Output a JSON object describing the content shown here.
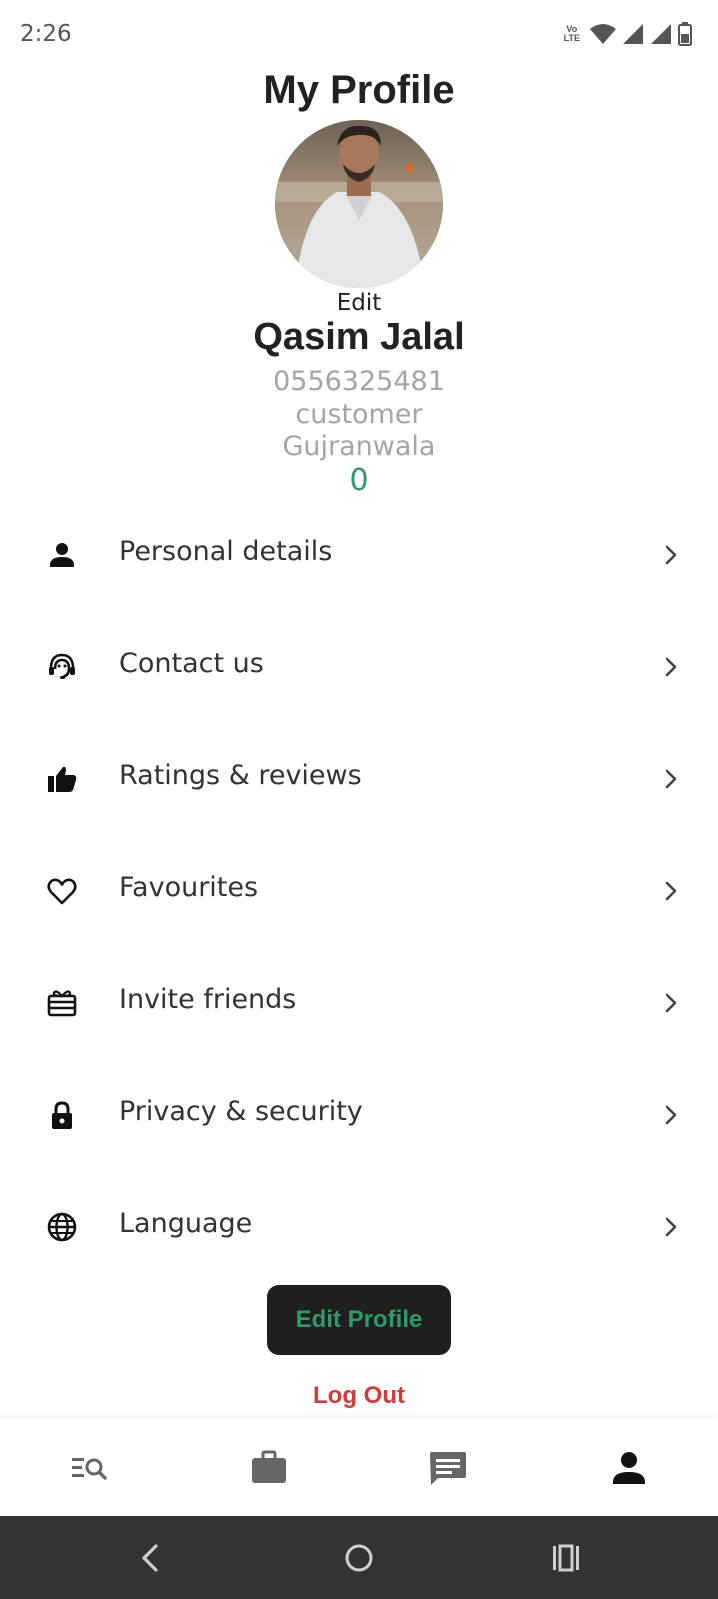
{
  "status_bar": {
    "time": "2:26",
    "volte_line1": "Vo",
    "volte_line2": "LTE",
    "icons": [
      "volte-icon",
      "wifi-icon",
      "signal-icon",
      "signal-icon",
      "battery-icon"
    ]
  },
  "header": {
    "title": "My Profile"
  },
  "profile": {
    "avatar_icon": "profile-photo",
    "edit_label": "Edit",
    "name": "Qasim Jalal",
    "phone": "0556325481",
    "role": "customer",
    "city": "Gujranwala",
    "count": "0"
  },
  "menu": {
    "items": [
      {
        "label": "Personal details",
        "icon": "person-icon"
      },
      {
        "label": "Contact us",
        "icon": "support-agent-icon"
      },
      {
        "label": "Ratings & reviews",
        "icon": "thumb-up-icon"
      },
      {
        "label": "Favourites",
        "icon": "heart-icon"
      },
      {
        "label": "Invite friends",
        "icon": "gift-card-icon"
      },
      {
        "label": "Privacy & security",
        "icon": "lock-icon"
      },
      {
        "label": "Language",
        "icon": "globe-icon"
      }
    ]
  },
  "actions": {
    "edit_profile_label": "Edit Profile",
    "logout_label": "Log Out"
  },
  "bottom_nav": {
    "items": [
      {
        "icon": "search-list-icon",
        "active": false
      },
      {
        "icon": "briefcase-icon",
        "active": false
      },
      {
        "icon": "chat-icon",
        "active": false
      },
      {
        "icon": "person-icon",
        "active": true
      }
    ]
  },
  "colors": {
    "accent_green": "#2e9a6b",
    "logout_red": "#d33a3a",
    "button_dark": "#1f1f1f",
    "system_nav": "#333333"
  }
}
